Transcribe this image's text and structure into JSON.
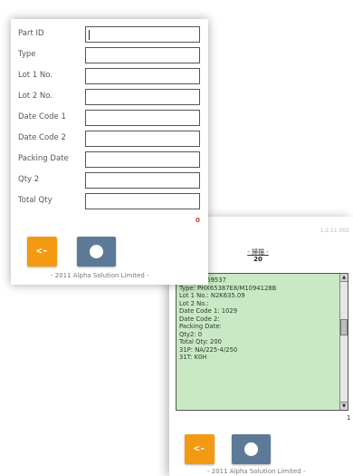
{
  "front_form": {
    "fields": [
      {
        "label": "Part ID",
        "value": ""
      },
      {
        "label": "Type",
        "value": ""
      },
      {
        "label": "Lot 1 No.",
        "value": ""
      },
      {
        "label": "Lot 2 No.",
        "value": ""
      },
      {
        "label": "Date Code 1",
        "value": ""
      },
      {
        "label": "Date Code 2",
        "value": ""
      },
      {
        "label": "Packing Date",
        "value": ""
      },
      {
        "label": "Qty 2",
        "value": ""
      },
      {
        "label": "Total Qty",
        "value": ""
      }
    ],
    "scan_count": "0",
    "back_button_label": "<-",
    "footer": "- 2011 Alpha Solution Limited -"
  },
  "back_panel": {
    "version": "1.2.11.002",
    "header_title": "- 掃描 -",
    "header_count": "20",
    "info_lines": [
      "935291059537",
      "Type: PHX65387E8/M1094128B",
      "Lot 1 No.: N2K635.09",
      "Lot 2 No.:",
      "Date Code 1: 1029",
      "Date Code 2:",
      "Packing Date:",
      "Qty2: 0",
      "Total Qty: 200",
      "31P: NA/225-4/250",
      "31T: K0H"
    ],
    "page_counter": "1",
    "back_button_label": "<-",
    "footer": "- 2011 Alpha Solution Limited -"
  },
  "icons": {
    "ok_button": "circle-icon",
    "scroll_up": "arrow-up-icon",
    "scroll_down": "arrow-down-icon"
  },
  "colors": {
    "back_button": "#f39a12",
    "ok_button": "#5c7a97",
    "info_box": "#c9e9c4",
    "count_red": "#c0392b"
  }
}
